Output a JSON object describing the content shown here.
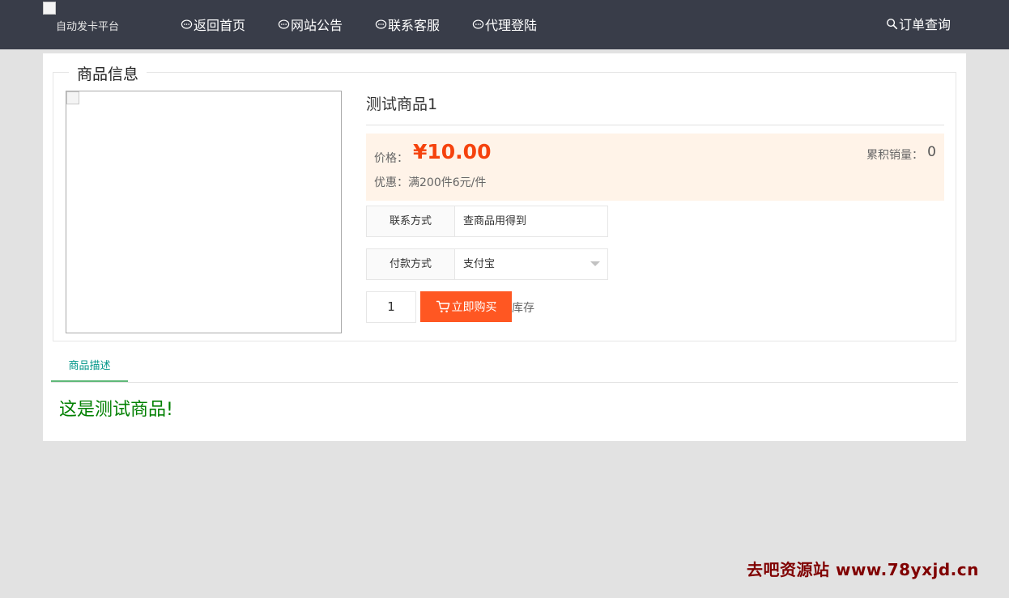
{
  "header": {
    "logo_text": "自动发卡平台",
    "nav": [
      {
        "label": "返回首页",
        "icon": "chat-bubble-icon"
      },
      {
        "label": "网站公告",
        "icon": "chat-bubble-icon"
      },
      {
        "label": "联系客服",
        "icon": "chat-bubble-icon"
      },
      {
        "label": "代理登陆",
        "icon": "chat-bubble-icon"
      }
    ],
    "order_query": {
      "label": "订单查询",
      "icon": "search-icon"
    }
  },
  "product": {
    "section_title": "商品信息",
    "name": "测试商品1",
    "price_label": "价格：",
    "price": "¥10.00",
    "sales_label": "累积销量：",
    "sales_count": "0",
    "discount": "优惠：满200件6元/件",
    "contact_label": "联系方式",
    "contact_placeholder": "查商品用得到",
    "payment_label": "付款方式",
    "payment_selected": "支付宝",
    "quantity": "1",
    "buy_button": "立即购买",
    "stock_label": "库存"
  },
  "tabs": [
    {
      "label": "商品描述",
      "active": true
    }
  ],
  "description": "这是测试商品!",
  "watermark": "去吧资源站 www.78yxjd.cn",
  "colors": {
    "nav_bg": "#393d49",
    "accent": "#ff5722",
    "price": "#f5420d",
    "tab_active": "#009688",
    "description": "#008000"
  }
}
